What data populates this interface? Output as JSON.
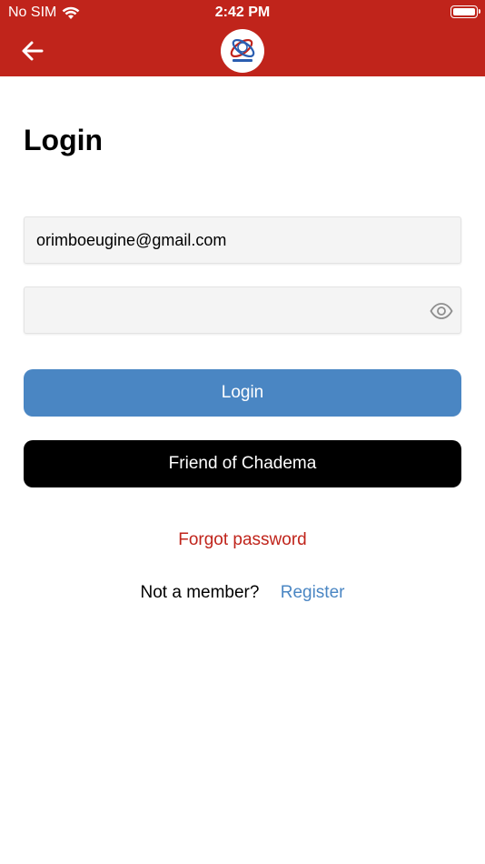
{
  "status_bar": {
    "carrier": "No SIM",
    "time": "2:42 PM"
  },
  "header": {
    "back_icon": "arrow-left-icon",
    "logo_icon": "chadema-logo-icon",
    "color": "#c0241b"
  },
  "page": {
    "title": "Login"
  },
  "form": {
    "email_value": "orimboeugine@gmail.com",
    "password_value": "",
    "password_toggle_icon": "eye-icon"
  },
  "buttons": {
    "login_label": "Login",
    "login_color": "#4a86c3",
    "friend_label": "Friend of Chadema",
    "friend_color": "#000000"
  },
  "links": {
    "forgot_label": "Forgot password",
    "not_member_label": "Not a member?",
    "register_label": "Register"
  }
}
